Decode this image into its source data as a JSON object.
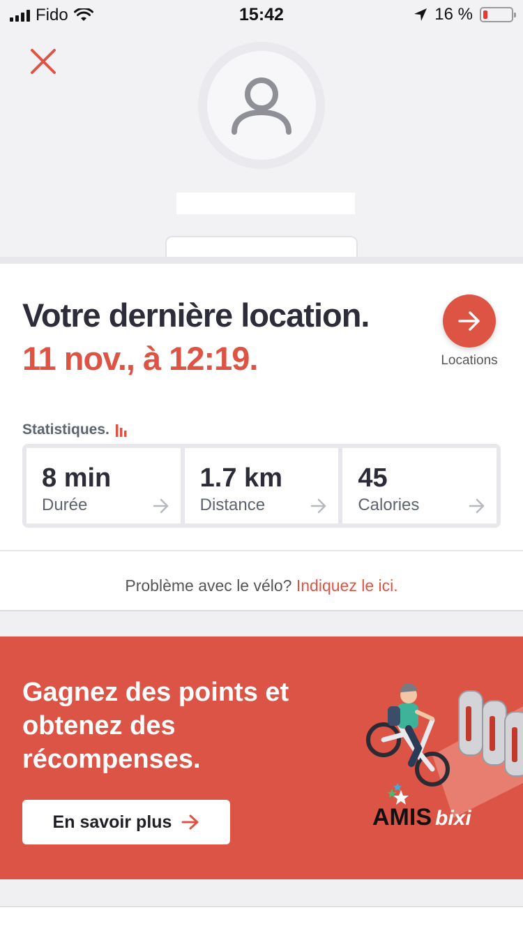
{
  "status_bar": {
    "carrier": "Fido",
    "time": "15:42",
    "battery_percent": "16 %",
    "battery_level": 0.16
  },
  "profile": {
    "avatar_icon": "person-icon",
    "close_icon": "close-icon"
  },
  "last_rental": {
    "title": "Votre dernière location.",
    "date": "11 nov., à 12:19.",
    "locations_label": "Locations"
  },
  "stats": {
    "title": "Statistiques.",
    "items": [
      {
        "value": "8 min",
        "label": "Durée"
      },
      {
        "value": "1.7 km",
        "label": "Distance"
      },
      {
        "value": "45",
        "label": "Calories"
      }
    ]
  },
  "problem": {
    "text": "Problème avec le vélo?",
    "link": "Indiquez le ici."
  },
  "promo": {
    "title": "Gagnez des points et obtenez des récompenses.",
    "button_label": "En savoir plus",
    "brand": "AMIS bixi"
  },
  "colors": {
    "accent": "#de5444",
    "promo_bg": "#dc5445",
    "text_dark": "#2c2c38"
  }
}
